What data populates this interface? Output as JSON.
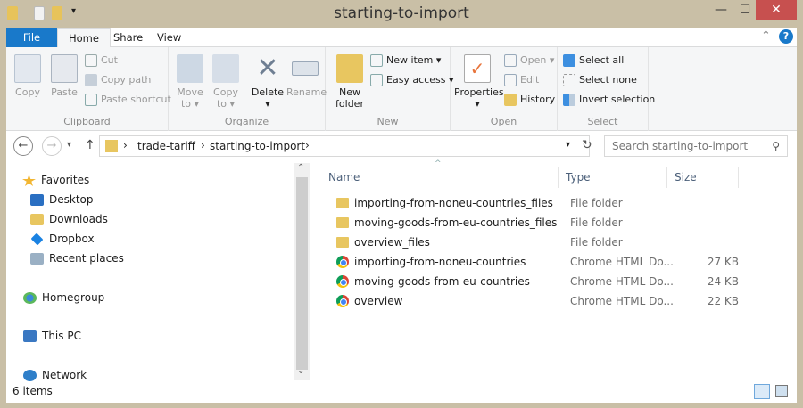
{
  "window": {
    "title": "starting-to-import",
    "minimize": "—",
    "maximize": "☐",
    "close": "✕"
  },
  "tabs": {
    "file": "File",
    "home": "Home",
    "share": "Share",
    "view": "View",
    "collapse": "⌃",
    "help": "?"
  },
  "ribbon": {
    "clipboard": {
      "label": "Clipboard",
      "copy": "Copy",
      "paste": "Paste",
      "cut": "Cut",
      "copy_path": "Copy path",
      "paste_shortcut": "Paste shortcut"
    },
    "organize": {
      "label": "Organize",
      "move_to": "Move to ▾",
      "copy_to": "Copy to ▾",
      "delete": "Delete",
      "delete_arrow": "▾",
      "rename": "Rename"
    },
    "new": {
      "label": "New",
      "new_folder": "New folder",
      "new_item": "New item ▾",
      "easy_access": "Easy access ▾"
    },
    "open": {
      "label": "Open",
      "properties": "Properties",
      "properties_arrow": "▾",
      "open": "Open ▾",
      "edit": "Edit",
      "history": "History"
    },
    "select": {
      "label": "Select",
      "select_all": "Select all",
      "select_none": "Select none",
      "invert": "Invert selection"
    }
  },
  "address": {
    "back": "←",
    "forward": "→",
    "recent": "▾",
    "up": "↑",
    "crumbs": [
      "trade-tariff",
      "starting-to-import"
    ],
    "sep": "›",
    "dropdown": "▾",
    "refresh": "↻",
    "search_placeholder": "Search starting-to-import",
    "search_icon": "⚲"
  },
  "nav": {
    "items": [
      {
        "label": "Favorites",
        "icon": "star-icon"
      },
      {
        "label": "Desktop",
        "icon": "desktop-icon"
      },
      {
        "label": "Downloads",
        "icon": "downloads-icon"
      },
      {
        "label": "Dropbox",
        "icon": "dropbox-icon"
      },
      {
        "label": "Recent places",
        "icon": "recent-places-icon"
      },
      {
        "label": "Homegroup",
        "icon": "homegroup-icon"
      },
      {
        "label": "This PC",
        "icon": "pc-icon"
      },
      {
        "label": "Network",
        "icon": "network-icon"
      }
    ],
    "scroll_up": "⌃",
    "scroll_down": "⌄"
  },
  "list": {
    "columns": {
      "name": "Name",
      "type": "Type",
      "size": "Size"
    },
    "sort_indicator": "^",
    "rows": [
      {
        "name": "importing-from-noneu-countries_files",
        "type": "File folder",
        "size": "",
        "icon": "folder"
      },
      {
        "name": "moving-goods-from-eu-countries_files",
        "type": "File folder",
        "size": "",
        "icon": "folder"
      },
      {
        "name": "overview_files",
        "type": "File folder",
        "size": "",
        "icon": "folder"
      },
      {
        "name": "importing-from-noneu-countries",
        "type": "Chrome HTML Do...",
        "size": "27 KB",
        "icon": "chrome"
      },
      {
        "name": "moving-goods-from-eu-countries",
        "type": "Chrome HTML Do...",
        "size": "24 KB",
        "icon": "chrome"
      },
      {
        "name": "overview",
        "type": "Chrome HTML Do...",
        "size": "22 KB",
        "icon": "chrome"
      }
    ]
  },
  "status": {
    "count": "6 items"
  },
  "colors": {
    "accent": "#1979ca",
    "frame": "#c9bfa6",
    "close": "#c7504f"
  }
}
